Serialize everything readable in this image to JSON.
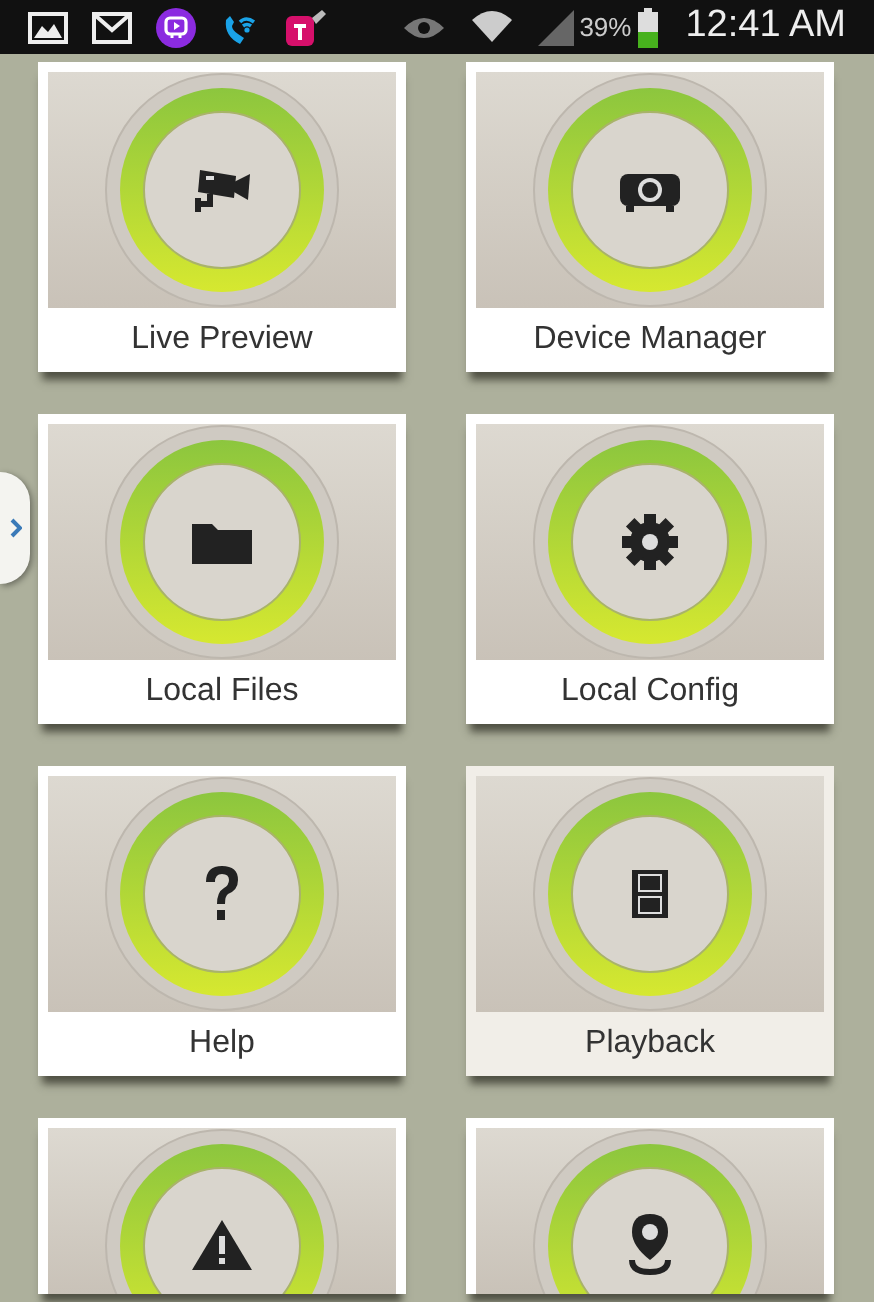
{
  "status_bar": {
    "battery": "39%",
    "time": "12:41 AM"
  },
  "tiles": [
    {
      "label": "Live Preview",
      "kind": "camera",
      "selected": false
    },
    {
      "label": "Device Manager",
      "kind": "projector",
      "selected": false
    },
    {
      "label": "Local Files",
      "kind": "folder",
      "selected": false
    },
    {
      "label": "Local Config",
      "kind": "gear",
      "selected": false
    },
    {
      "label": "Help",
      "kind": "help",
      "selected": false
    },
    {
      "label": "Playback",
      "kind": "film",
      "selected": true
    },
    {
      "kind": "warning",
      "selected": false
    },
    {
      "kind": "pin",
      "selected": false
    }
  ]
}
